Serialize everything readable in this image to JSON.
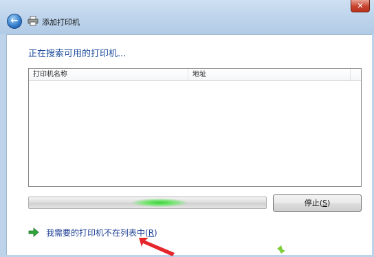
{
  "window": {
    "title": "添加打印机",
    "close_label": "✕",
    "back_label": "←"
  },
  "main": {
    "heading": "正在搜索可用的打印机...",
    "columns": [
      "打印机名称",
      "地址"
    ],
    "progress_state": "searching (indeterminate)",
    "stop_button": {
      "label": "停止",
      "mnemonic": "S"
    },
    "missing_link": {
      "label": "我需要的打印机不在列表中",
      "mnemonic": "R"
    }
  },
  "colors": {
    "heading": "#1d4c9c",
    "link": "#1c3f94",
    "progress_glow": "#38d33a",
    "annotation_arrow": "#e5262a"
  },
  "icons": [
    "back-arrow-icon",
    "printer-icon",
    "green-arrow-icon"
  ]
}
